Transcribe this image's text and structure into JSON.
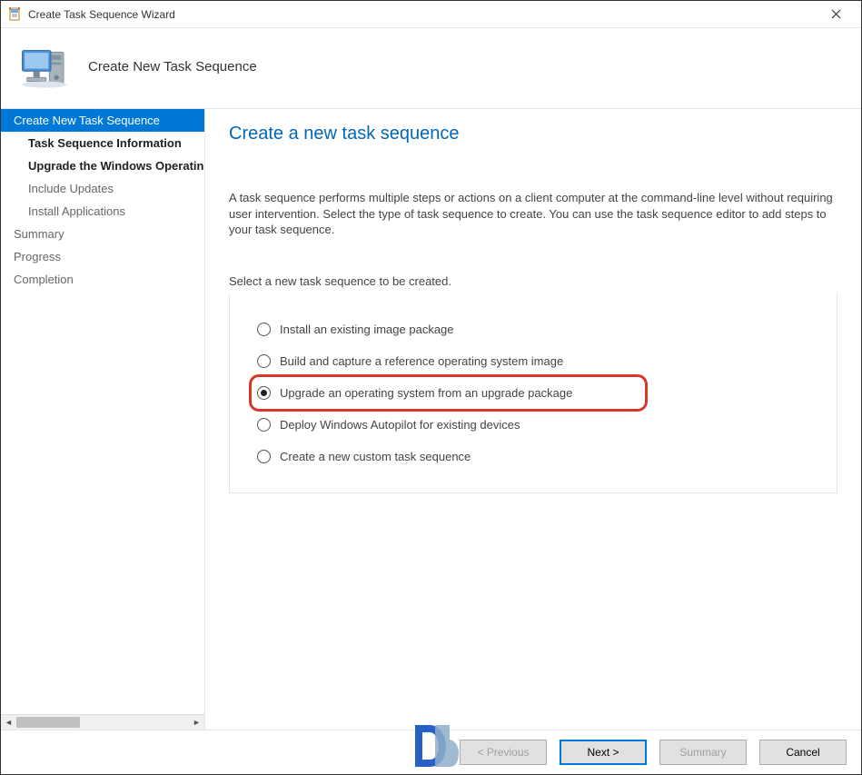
{
  "window": {
    "title": "Create Task Sequence Wizard"
  },
  "header": {
    "title": "Create New Task Sequence"
  },
  "sidebar": {
    "steps": [
      {
        "label": "Create New Task Sequence",
        "state": "active"
      },
      {
        "label": "Task Sequence Information",
        "state": "bold sub"
      },
      {
        "label": "Upgrade the Windows Operating System",
        "state": "bold sub"
      },
      {
        "label": "Include Updates",
        "state": "dim sub"
      },
      {
        "label": "Install Applications",
        "state": "dim sub"
      },
      {
        "label": "Summary",
        "state": "dim"
      },
      {
        "label": "Progress",
        "state": "dim"
      },
      {
        "label": "Completion",
        "state": "dim"
      }
    ]
  },
  "content": {
    "page_title": "Create a new task sequence",
    "intro": "A task sequence performs multiple steps or actions on a client computer at the command-line level without requiring user intervention. Select the type of task sequence to create. You can use the task sequence editor to add steps to your task sequence.",
    "select_label": "Select a new task sequence to be created.",
    "options": [
      {
        "label": "Install an existing image package",
        "checked": false,
        "highlight": false
      },
      {
        "label": "Build and capture a reference operating system image",
        "checked": false,
        "highlight": false
      },
      {
        "label": "Upgrade an operating system from an upgrade package",
        "checked": true,
        "highlight": true
      },
      {
        "label": "Deploy Windows Autopilot for existing devices",
        "checked": false,
        "highlight": false
      },
      {
        "label": "Create a new custom task sequence",
        "checked": false,
        "highlight": false
      }
    ]
  },
  "footer": {
    "previous": "< Previous",
    "next": "Next >",
    "summary": "Summary",
    "cancel": "Cancel"
  }
}
